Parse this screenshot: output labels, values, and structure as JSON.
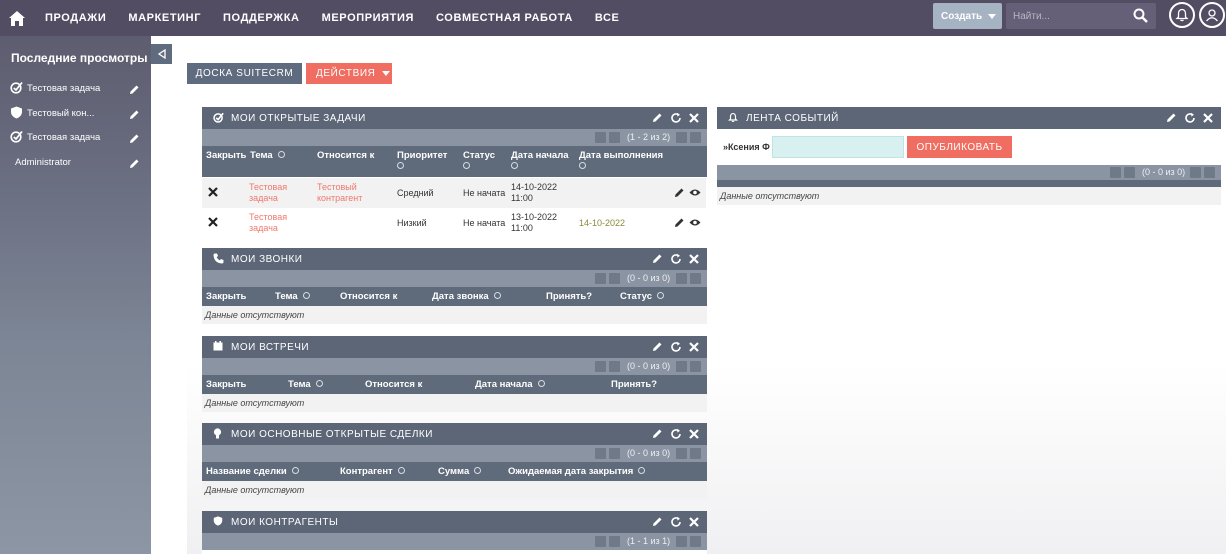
{
  "nav": {
    "items": [
      "ПРОДАЖИ",
      "МАРКЕТИНГ",
      "ПОДДЕРЖКА",
      "МЕРОПРИЯТИЯ",
      "СОВМЕСТНАЯ РАБОТА",
      "ВСЕ"
    ],
    "create_label": "Создать",
    "search_placeholder": "Найти...",
    "icons": [
      "home-icon",
      "search-icon",
      "bell-icon",
      "user-icon"
    ]
  },
  "sidebar": {
    "title": "Последние просмотры",
    "items": [
      {
        "label": "Тестовая задача",
        "icon": "task-icon"
      },
      {
        "label": "Тестовый кон...",
        "icon": "shield-icon"
      },
      {
        "label": "Тестовая задача",
        "icon": "task-icon"
      },
      {
        "label": "Administrator",
        "icon": ""
      }
    ]
  },
  "toolbar": {
    "board_tab": "ДОСКА SUITECRM",
    "actions_label": "ДЕЙСТВИЯ"
  },
  "dashlets": {
    "tasks": {
      "title": "МОИ ОТКРЫТЫЕ ЗАДАЧИ",
      "pager": "(1 - 2 из 2)",
      "columns": [
        "Закрыть",
        "Тема",
        "Относится к",
        "Приоритет",
        "Статус",
        "Дата начала",
        "Дата выполнения"
      ],
      "rows": [
        {
          "subject_1": "Тестовая",
          "subject_2": "задача",
          "related_1": "Тестовый",
          "related_2": "контрагент",
          "priority": "Средний",
          "status": "Не начата",
          "start_1": "14-10-2022",
          "start_2": "11:00",
          "due": ""
        },
        {
          "subject_1": "Тестовая",
          "subject_2": "задача",
          "related_1": "",
          "related_2": "",
          "priority": "Низкий",
          "status": "Не начата",
          "start_1": "13-10-2022",
          "start_2": "11:00",
          "due": "14-10-2022"
        }
      ]
    },
    "calls": {
      "title": "МОИ ЗВОНКИ",
      "pager": "(0 - 0 из 0)",
      "columns": [
        "Закрыть",
        "Тема",
        "Относится к",
        "Дата звонка",
        "Принять?",
        "Статус"
      ],
      "empty": "Данные отсутствуют"
    },
    "meetings": {
      "title": "МОИ ВСТРЕЧИ",
      "pager": "(0 - 0 из 0)",
      "columns": [
        "Закрыть",
        "Тема",
        "Относится к",
        "Дата начала",
        "Принять?"
      ],
      "empty": "Данные отсутствуют"
    },
    "deals": {
      "title": "МОИ ОСНОВНЫЕ ОТКРЫТЫЕ СДЕЛКИ",
      "pager": "(0 - 0 из 0)",
      "columns": [
        "Название сделки",
        "Контрагент",
        "Сумма",
        "Ожидаемая дата закрытия"
      ],
      "empty": "Данные отсутствуют"
    },
    "accounts": {
      "title": "МОИ КОНТРАГЕНТЫ",
      "pager": "(1 - 1 из 1)"
    },
    "feed": {
      "title": "ЛЕНТА СОБЫТИЙ",
      "user_label": "Ксения Ф",
      "input_value": "",
      "post_label": "ОПУБЛИКОВАТЬ",
      "pager": "(0 - 0 из 0)",
      "empty": "Данные отсутствуют"
    }
  },
  "colors": {
    "nav_bg": "#534d64",
    "accent": "#f06e61",
    "dashlet_header": "#5c6677",
    "link": "#f0786d"
  }
}
